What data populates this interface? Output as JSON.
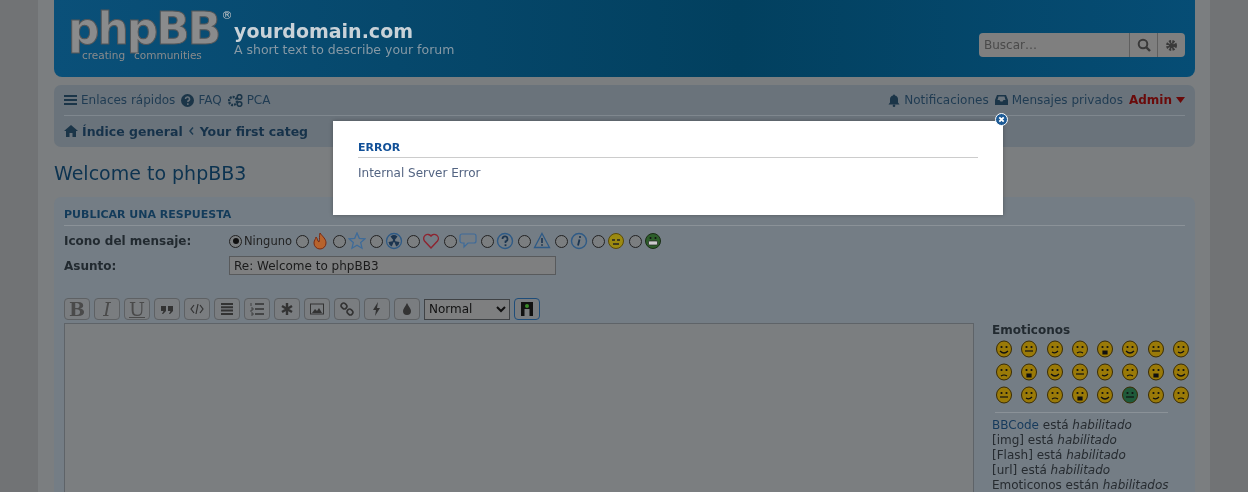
{
  "header": {
    "site_title": "yourdomain.com",
    "site_description": "A short text to describe your forum",
    "logo": {
      "wordmark": "phpBB",
      "registered": "®",
      "tagline_left": "creating",
      "tagline_right": "communities"
    },
    "search": {
      "placeholder": "Buscar…"
    }
  },
  "navbar": {
    "left_links": [
      {
        "kind": "menu",
        "label": "Enlaces rápidos"
      },
      {
        "kind": "help",
        "label": "FAQ"
      },
      {
        "kind": "gears",
        "label": "PCA"
      }
    ],
    "right_links": [
      {
        "kind": "bell",
        "label": "Notificaciones"
      },
      {
        "kind": "inbox",
        "label": "Mensajes privados"
      },
      {
        "kind": "user",
        "label": "Admin"
      }
    ],
    "breadcrumbs": [
      {
        "kind": "home",
        "label": "Índice general"
      },
      {
        "kind": "crumb",
        "label": "Your first categ"
      }
    ]
  },
  "topic_title": "Welcome to phpBB3",
  "post_form": {
    "heading": "PUBLICAR UNA RESPUESTA",
    "icon_label": "Icono del mensaje:",
    "icons": [
      {
        "kind": "none",
        "label": "Ninguno",
        "selected": true
      },
      {
        "kind": "fire",
        "selected": false
      },
      {
        "kind": "star",
        "selected": false
      },
      {
        "kind": "radioactive",
        "selected": false
      },
      {
        "kind": "heart",
        "selected": false
      },
      {
        "kind": "speech",
        "selected": false
      },
      {
        "kind": "question",
        "selected": false
      },
      {
        "kind": "warning",
        "selected": false
      },
      {
        "kind": "info",
        "selected": false
      },
      {
        "kind": "wink",
        "selected": false
      },
      {
        "kind": "grin",
        "selected": false
      }
    ],
    "subject_label": "Asunto:",
    "subject_value": "Re: Welcome to phpBB3",
    "toolbar": [
      {
        "kind": "bold",
        "label": "B"
      },
      {
        "kind": "italic",
        "label": "I"
      },
      {
        "kind": "underline",
        "label": "U"
      },
      {
        "kind": "quote"
      },
      {
        "kind": "code"
      },
      {
        "kind": "list"
      },
      {
        "kind": "numbered-list"
      },
      {
        "kind": "asterisk"
      },
      {
        "kind": "image"
      },
      {
        "kind": "link"
      },
      {
        "kind": "flash"
      },
      {
        "kind": "drop"
      },
      {
        "kind": "select",
        "label": "Normal"
      },
      {
        "kind": "color"
      }
    ],
    "emoticons_heading": "Emoticonos",
    "status_lines": [
      {
        "kind": "link",
        "link": "BBCode",
        "text": " está *habilitado*"
      },
      {
        "kind": "plain",
        "text": "[img] está *habilitado*"
      },
      {
        "kind": "plain",
        "text": "[Flash] está *habilitado*"
      },
      {
        "kind": "plain",
        "text": "[url] está *habilitado*"
      },
      {
        "kind": "plain",
        "text": "Emoticonos están *habilitados*"
      }
    ]
  },
  "error_dialog": {
    "title": "ERROR",
    "message": "Internal Server Error"
  }
}
